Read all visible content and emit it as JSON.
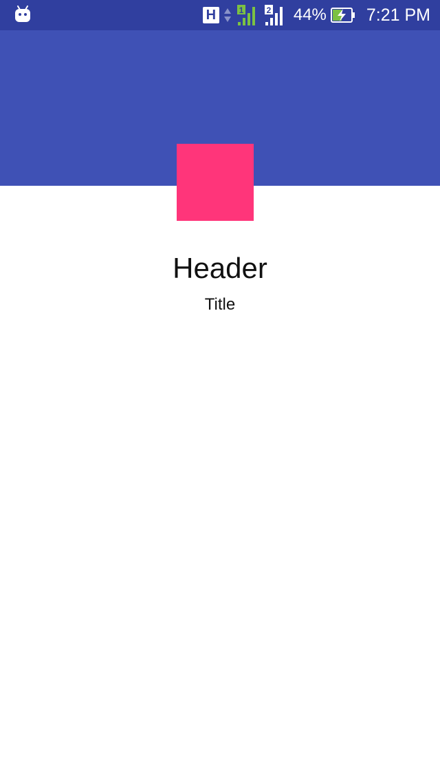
{
  "status_bar": {
    "network_type": "H",
    "sim1_label": "1",
    "sim2_label": "2",
    "battery_percent": "44%",
    "time": "7:21 PM",
    "colors": {
      "background": "#303F9F",
      "signal_active": "#7CC143"
    },
    "icons": [
      "android-icon",
      "data-arrows-icon",
      "signal-sim1-icon",
      "signal-sim2-icon",
      "battery-charging-icon"
    ]
  },
  "app_bar": {
    "color": "#3F51B5"
  },
  "avatar": {
    "color": "#FF357A"
  },
  "content": {
    "header": "Header",
    "title": "Title"
  }
}
